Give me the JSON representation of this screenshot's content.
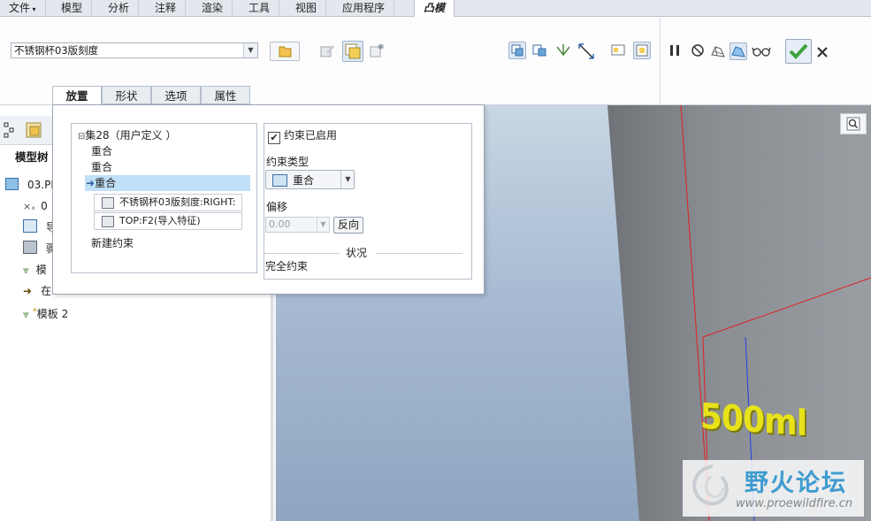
{
  "menubar": {
    "tabs": [
      {
        "label": "文件",
        "has_arrow": true
      },
      {
        "label": "模型"
      },
      {
        "label": "分析"
      },
      {
        "label": "注释"
      },
      {
        "label": "渲染"
      },
      {
        "label": "工具"
      },
      {
        "label": "视图"
      },
      {
        "label": "应用程序"
      },
      {
        "label": "凸模",
        "active": true
      }
    ]
  },
  "ribbon": {
    "component_name": "不锈钢杯03版刻度",
    "ok_color": "#3ea33b",
    "cancel_color": "#333333"
  },
  "dashboard_tabs": [
    {
      "label": "放置",
      "active": true
    },
    {
      "label": "形状"
    },
    {
      "label": "选项"
    },
    {
      "label": "属性"
    }
  ],
  "placement": {
    "set_label": "集28（用户定义 ）",
    "constraints": [
      "重合",
      "重合",
      "重合"
    ],
    "selected_index": 2,
    "references": [
      "不锈钢杯03版刻度:RIGHT:",
      "TOP:F2(导入特征)"
    ],
    "new_constraint": "新建约束",
    "enabled_label": "约束已启用",
    "enabled": true,
    "type_heading": "约束类型",
    "type_value": "重合",
    "offset_heading": "偏移",
    "offset_value": "0.00",
    "flip_label": "反向",
    "status_heading": "状况",
    "status_value": "完全约束"
  },
  "model_tree": {
    "heading": "模型树",
    "items": [
      {
        "label": "03.PF",
        "icon": "part-icon"
      },
      {
        "label": "0",
        "icon": "csys-icon"
      },
      {
        "label": "导",
        "icon": "import-icon"
      },
      {
        "label": "骤",
        "icon": "step-icon"
      },
      {
        "label": "模",
        "icon": "template-icon"
      },
      {
        "label": "在",
        "icon": "insert-arrow-icon"
      },
      {
        "label": "模板 2",
        "icon": "template-icon",
        "marker": "*"
      }
    ]
  },
  "viewport": {
    "engraving": "500ml"
  },
  "watermark": {
    "title": "野火论坛",
    "url": "www.proewildfire.cn"
  }
}
